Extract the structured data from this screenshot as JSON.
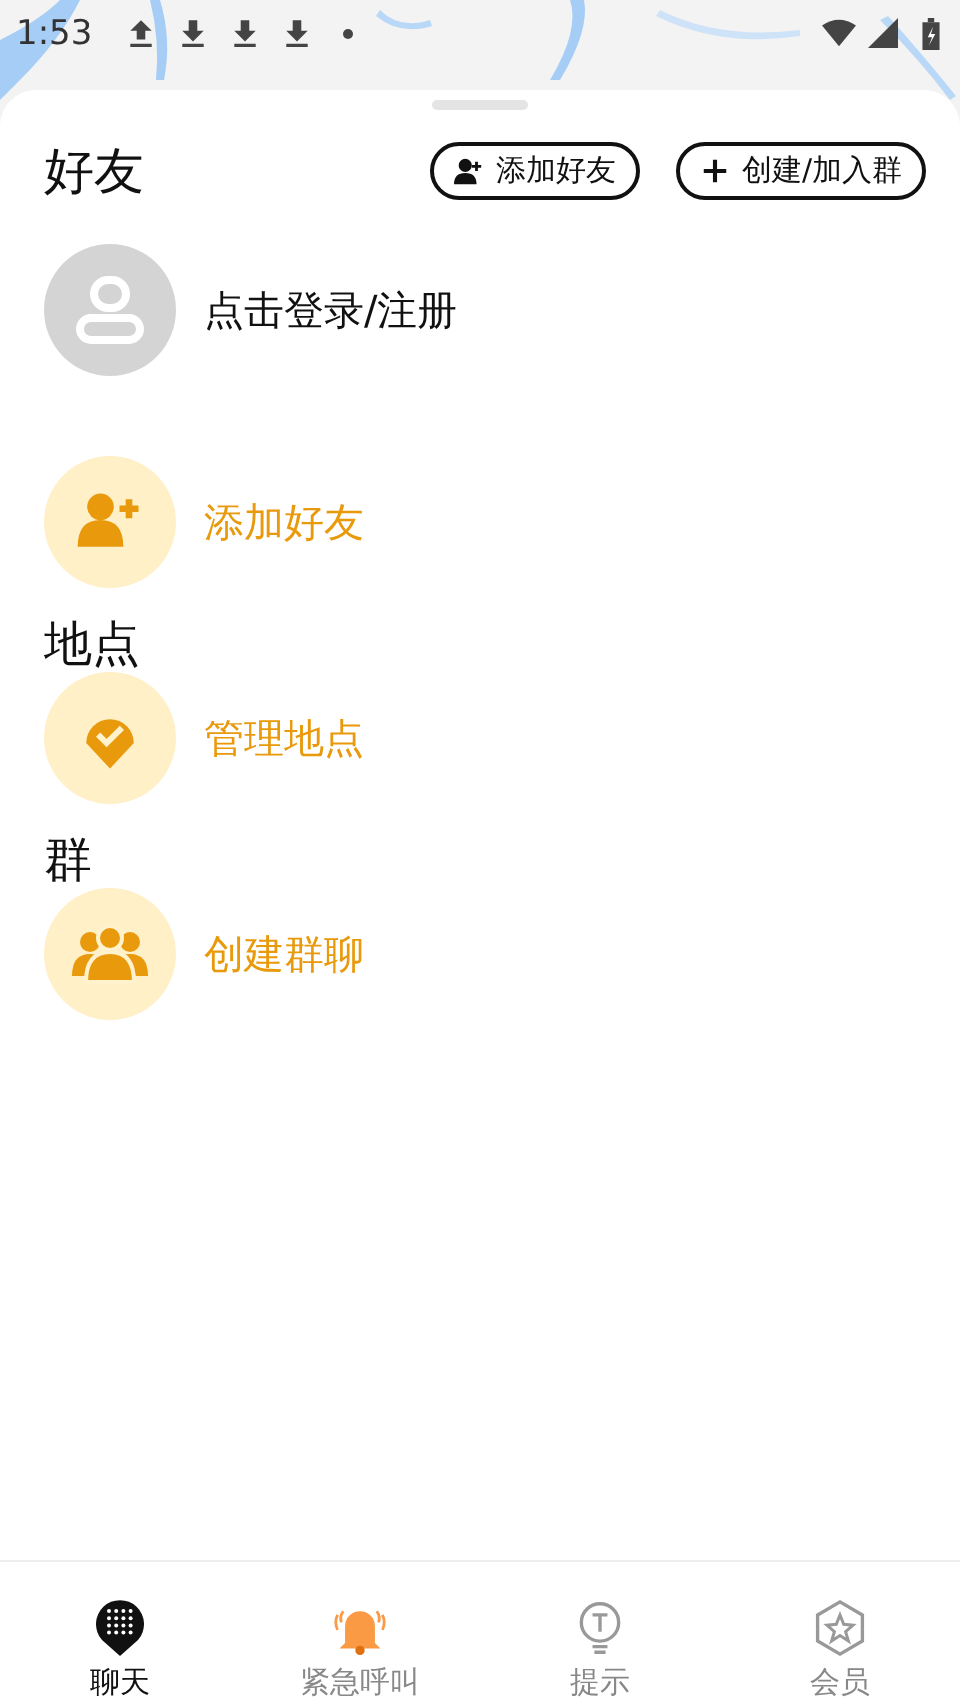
{
  "status_bar": {
    "time": "1:53"
  },
  "header": {
    "title": "好友",
    "buttons": [
      {
        "kind": "add-friend",
        "label": "添加好友"
      },
      {
        "kind": "create-group",
        "label": "创建/加入群"
      }
    ]
  },
  "rows": [
    {
      "kind": "login",
      "label": "点击登录/注册"
    },
    {
      "kind": "add-friend",
      "label": "添加好友"
    },
    {
      "kind": "heading",
      "label": "地点"
    },
    {
      "kind": "location",
      "label": "管理地点"
    },
    {
      "kind": "heading",
      "label": "群"
    },
    {
      "kind": "group",
      "label": "创建群聊"
    }
  ],
  "tabs": [
    {
      "kind": "chat",
      "label": "聊天",
      "selected": true
    },
    {
      "kind": "alarm",
      "label": "紧急呼叫",
      "selected": false
    },
    {
      "kind": "tip",
      "label": "提示",
      "selected": false
    },
    {
      "kind": "member",
      "label": "会员",
      "selected": false
    }
  ]
}
